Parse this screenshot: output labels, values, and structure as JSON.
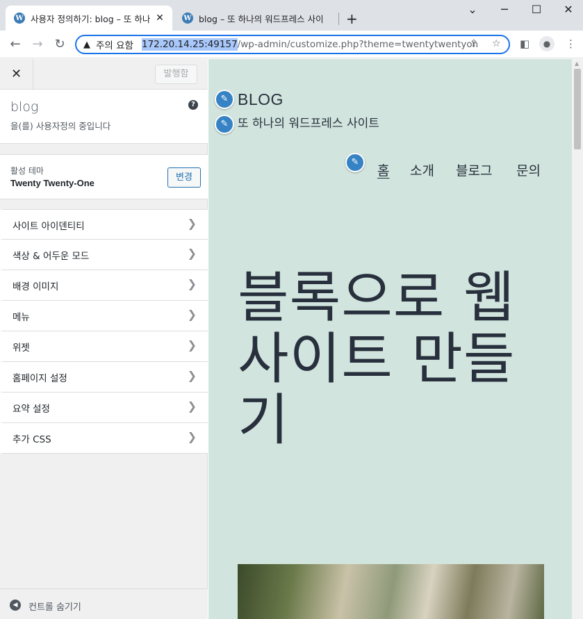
{
  "browser": {
    "tabs": [
      {
        "title": "사용자 정의하기: blog – 또 하나의",
        "active": true
      },
      {
        "title": "blog – 또 하나의 워드프레스 사이",
        "active": false
      }
    ],
    "new_tab": "+",
    "window_controls": {
      "minimize": "─",
      "maximize": "☐",
      "close": "✕",
      "menu": "⌄"
    },
    "nav": {
      "back": "←",
      "forward": "→",
      "reload": "↻"
    },
    "security_warning": "주의 요함",
    "url_host": "172.20.14.25:49157",
    "url_path": "/wp-admin/customize.php?theme=twentytwentyon"
  },
  "sidebar": {
    "close": "✕",
    "publish_label": "발행함",
    "site_name": "blog",
    "customizing_text": "을(를) 사용자정의 중입니다",
    "help": "?",
    "active_theme_label": "활성 테마",
    "theme_name": "Twenty Twenty-One",
    "change_label": "변경",
    "sections": [
      {
        "label": "사이트 아이덴티티"
      },
      {
        "label": "색상 & 어두운 모드"
      },
      {
        "label": "배경 이미지"
      },
      {
        "label": "메뉴"
      },
      {
        "label": "위젯"
      },
      {
        "label": "홈페이지 설정"
      },
      {
        "label": "요약 설정"
      },
      {
        "label": "추가 CSS"
      }
    ],
    "collapse_label": "컨트롤 숨기기"
  },
  "preview": {
    "site_title": "BLOG",
    "tagline": "또 하나의 워드프레스 사이트",
    "nav": [
      "홈",
      "소개",
      "블로그",
      "문의"
    ],
    "heading": "블록으로 웹사이트 만들기",
    "background_color": "#d1e4dd"
  }
}
